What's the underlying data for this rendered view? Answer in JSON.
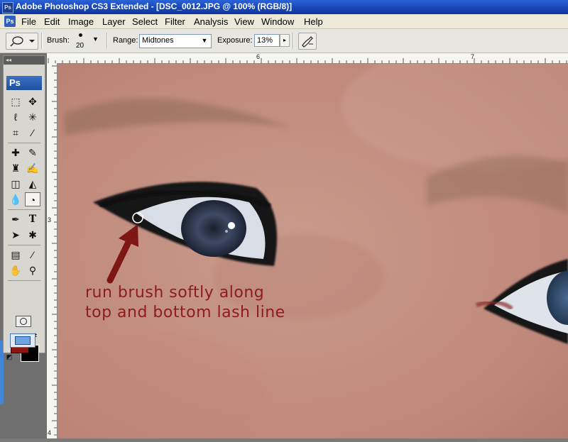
{
  "window": {
    "title": "Adobe Photoshop CS3 Extended - [DSC_0012.JPG @ 100% (RGB/8)]",
    "app_badge": "Ps"
  },
  "menu": [
    "File",
    "Edit",
    "Image",
    "Layer",
    "Select",
    "Filter",
    "Analysis",
    "View",
    "Window",
    "Help"
  ],
  "options_bar": {
    "brush_label": "Brush:",
    "brush_size": "20",
    "range_label": "Range:",
    "range_value": "Midtones",
    "exposure_label": "Exposure:",
    "exposure_value": "13%"
  },
  "toolbox": {
    "logo": "Ps",
    "collapse": "◂◂",
    "foreground_color": "#8e1410",
    "background_color": "#000000"
  },
  "rulers": {
    "top_marks": [
      "6",
      "7"
    ],
    "left_marks": [
      "3",
      "4"
    ]
  },
  "canvas": {
    "annotation_line1": "run brush softly along",
    "annotation_line2": "top and bottom lash line",
    "annotation_color": "#8e1c1a"
  }
}
